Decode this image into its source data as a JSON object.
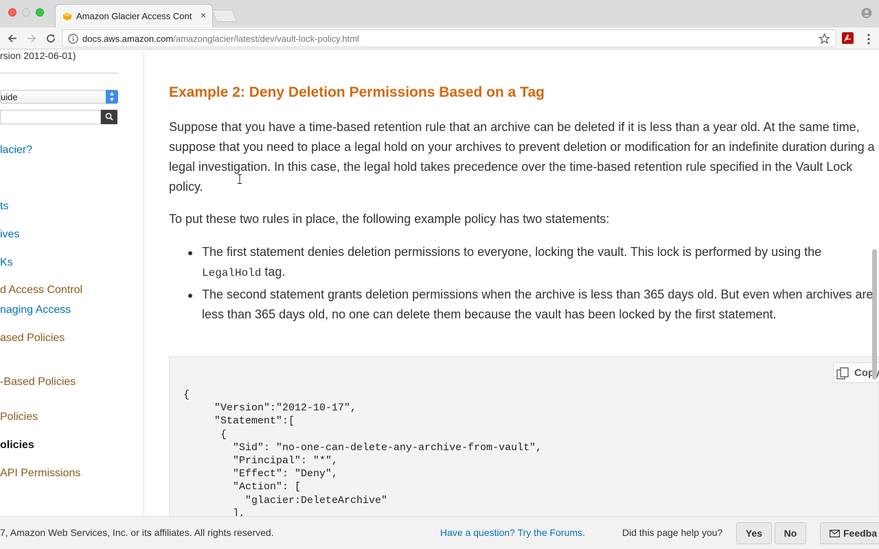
{
  "browser": {
    "tab_title": "Amazon Glacier Access Contro",
    "url_host": "docs.aws.amazon.com",
    "url_path": "/amazonglacier/latest/dev/vault-lock-policy.html"
  },
  "sidebar": {
    "version": "rsion 2012-06-01)",
    "guide_select": "uide",
    "search_placeholder": "",
    "items": [
      {
        "label": "lacier?",
        "color": "#0073bb"
      },
      {
        "label": "ts",
        "color": "#0073bb"
      },
      {
        "label": "ives",
        "color": "#0073bb"
      },
      {
        "label": "Ks",
        "color": "#0073bb"
      },
      {
        "label": "d Access Control",
        "color": "#8a5a1c"
      },
      {
        "label": "naging Access",
        "color": "#0073bb"
      },
      {
        "label": "ased Policies",
        "color": "#8a5a1c"
      },
      {
        "label": "-Based Policies",
        "color": "#8a5a1c"
      },
      {
        "label": "Policies",
        "color": "#8a5a1c"
      },
      {
        "label": "olicies",
        "color": "#111111"
      },
      {
        "label": "API Permissions",
        "color": "#8a5a1c"
      }
    ]
  },
  "main": {
    "heading": "Example 2: Deny Deletion Permissions Based on a Tag",
    "para1": "Suppose that you have a time-based retention rule that an archive can be deleted if it is less than a year old. At the same time, suppose that you need to place a legal hold on your archives to prevent deletion or modification for an indefinite duration during a legal investigation. In this case, the legal hold takes precedence over the time-based retention rule specified in the Vault Lock policy.",
    "para2": "To put these two rules in place, the following example policy has two statements:",
    "bullet1_pre": "The first statement denies deletion permissions to everyone, locking the vault. This lock is performed by using the ",
    "bullet1_code": "LegalHold",
    "bullet1_post": " tag.",
    "bullet2": "The second statement grants deletion permissions when the archive is less than 365 days old. But even when archives are less than 365 days old, no one can delete them because the vault has been locked by the first statement.",
    "copy_label": "Copy",
    "code": "{\n     \"Version\":\"2012-10-17\",\n     \"Statement\":[\n      {\n        \"Sid\": \"no-one-can-delete-any-archive-from-vault\",\n        \"Principal\": \"*\",\n        \"Effect\": \"Deny\",\n        \"Action\": [\n          \"glacier:DeleteArchive\"\n        ],"
  },
  "footer": {
    "copyright": "7, Amazon Web Services, Inc. or its affiliates. All rights reserved.",
    "forum_link": "Have a question? Try the Forums.",
    "helpful_question": "Did this page help you?",
    "yes": "Yes",
    "no": "No",
    "feedback": "Feedba"
  },
  "colors": {
    "heading": "#d2690f",
    "link_blue": "#0073bb",
    "link_brown": "#8a5a1c"
  }
}
